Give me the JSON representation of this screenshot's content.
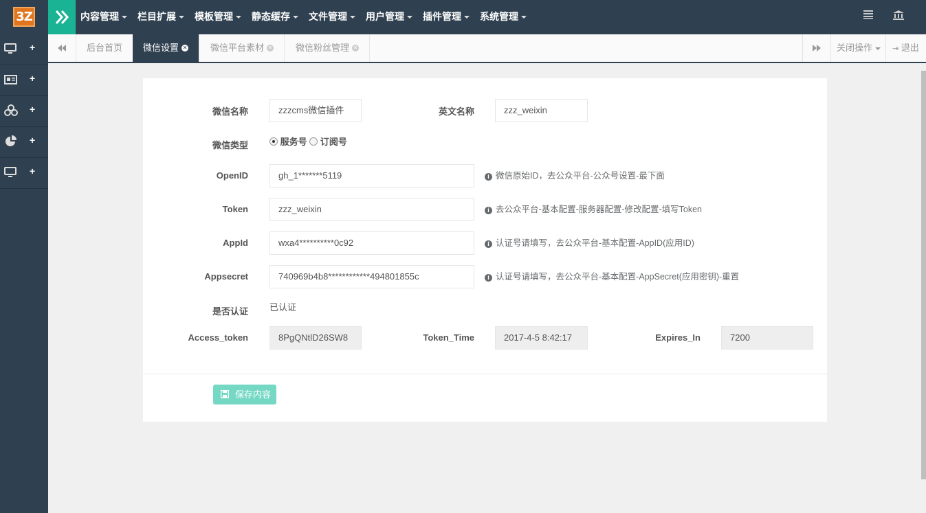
{
  "header": {
    "logo_text": "3Z",
    "nav": [
      {
        "label": "内容管理"
      },
      {
        "label": "栏目扩展"
      },
      {
        "label": "模板管理"
      },
      {
        "label": "静态缓存"
      },
      {
        "label": "文件管理"
      },
      {
        "label": "用户管理"
      },
      {
        "label": "插件管理"
      },
      {
        "label": "系统管理"
      }
    ]
  },
  "sidebar": {
    "items": [
      {
        "icon": "desktop-icon",
        "plus": "+"
      },
      {
        "icon": "newspaper-icon",
        "plus": "+"
      },
      {
        "icon": "cubes-icon",
        "plus": "+"
      },
      {
        "icon": "pie-chart-icon",
        "plus": "+"
      },
      {
        "icon": "desktop-icon",
        "plus": "+"
      }
    ]
  },
  "tabs": {
    "items": [
      {
        "label": "后台首页"
      },
      {
        "label": "微信设置"
      },
      {
        "label": "微信平台素材"
      },
      {
        "label": "微信粉丝管理"
      }
    ],
    "close_ops": "关闭操作",
    "logout": "退出"
  },
  "form": {
    "name_label": "微信名称",
    "name_value": "zzzcms微信插件",
    "en_label": "英文名称",
    "en_value": "zzz_weixin",
    "type_label": "微信类型",
    "type_opt1": "服务号",
    "type_opt2": "订阅号",
    "openid_label": "OpenID",
    "openid_value": "gh_1*******5119",
    "openid_help": "微信原始ID，去公众平台-公众号设置-最下面",
    "token_label": "Token",
    "token_value": "zzz_weixin",
    "token_help": "去公众平台-基本配置-服务器配置-修改配置-填写Token",
    "appid_label": "AppId",
    "appid_value": "wxa4**********0c92",
    "appid_help": "认证号请填写，去公众平台-基本配置-AppID(应用ID)",
    "secret_label": "Appsecret",
    "secret_value": "740969b4b8************494801855c",
    "secret_help": "认证号请填写，去公众平台-基本配置-AppSecret(应用密钥)-重置",
    "verified_label": "是否认证",
    "verified_value": "已认证",
    "access_label": "Access_token",
    "access_value": "8PgQNtlD26SW8",
    "tokentime_label": "Token_Time",
    "tokentime_value": "2017-4-5 8:42:17",
    "expires_label": "Expires_In",
    "expires_value": "7200",
    "save_label": "保存内容"
  },
  "colors": {
    "dark": "#2f4050",
    "accent": "#1ab394",
    "logo": "#e0761f"
  }
}
